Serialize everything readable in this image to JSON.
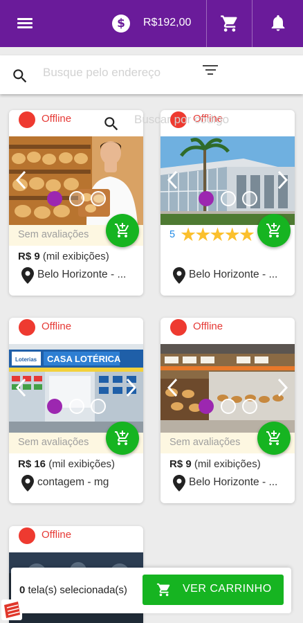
{
  "header": {
    "balance": "R$192,00",
    "coin_symbol": "$"
  },
  "search": {
    "address_placeholder": "Busque pelo endereço",
    "code_placeholder": "Buscar por código"
  },
  "listings": [
    {
      "status": "Offline",
      "image": "bakery-chef-photo",
      "rating_label": "Sem avaliações",
      "price_bold": "R$ 9",
      "price_suffix": "(mil exibições)",
      "location": "Belo Horizonte - ..."
    },
    {
      "status": "Offline",
      "image": "modern-building-photo",
      "rating_value": "5",
      "rating_stars": "★★★★★",
      "price_bold": "",
      "price_suffix": "",
      "location": "Belo Horizonte - ..."
    },
    {
      "status": "Offline",
      "image": "casa-loterica-photo",
      "image_sign": "CASA LOTÉRICA",
      "image_logo": "Loterias",
      "rating_label": "Sem avaliações",
      "price_bold": "R$ 16",
      "price_suffix": "(mil exibições)",
      "location": "contagem - mg"
    },
    {
      "status": "Offline",
      "image": "bakery-interior-photo",
      "rating_label": "Sem avaliações",
      "price_bold": "R$ 9",
      "price_suffix": "(mil exibições)",
      "location": "Belo Horizonte - ..."
    },
    {
      "status": "Offline",
      "image": "gym-photo"
    }
  ],
  "cart": {
    "selected_count": "0",
    "selected_label": "tela(s) selecionada(s)",
    "button_label": "VER CARRINHO"
  },
  "colors": {
    "primary": "#6a1b9a",
    "accent_purple": "#9c27b0",
    "cart_green": "#16b421",
    "offline_red": "#ee3a30",
    "star_yellow": "#fbc02d",
    "rating_bg": "#fdf7e1"
  }
}
